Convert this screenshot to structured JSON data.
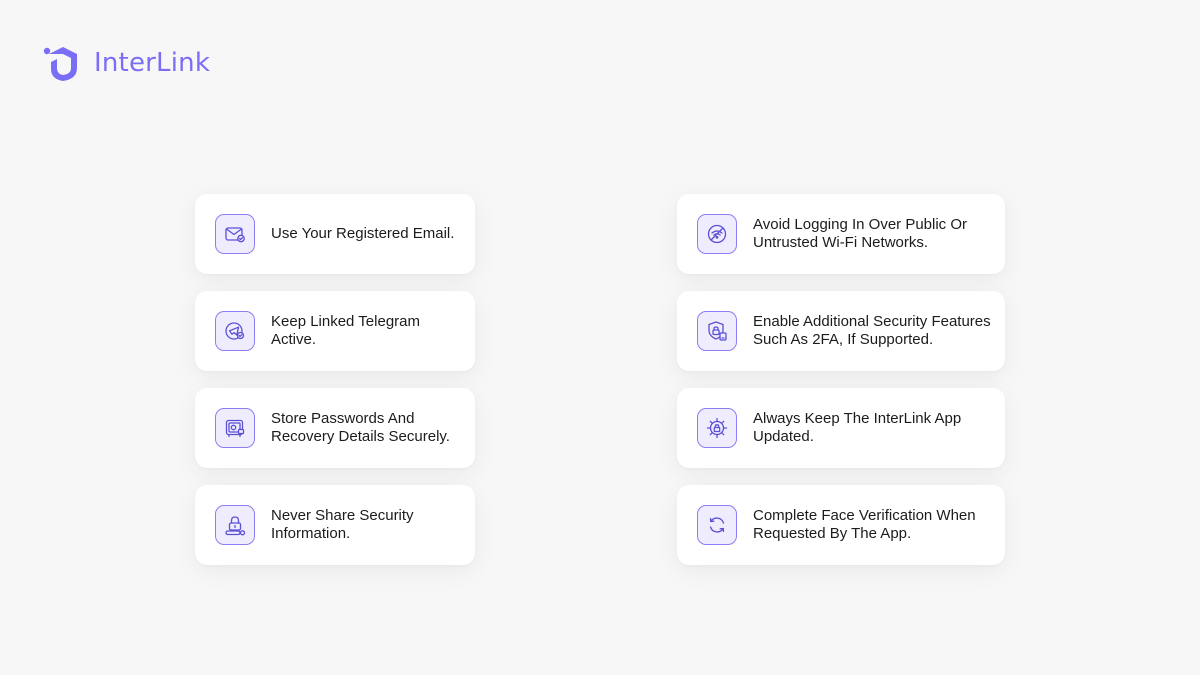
{
  "brand": {
    "name": "InterLink",
    "accent": "#7b6ef6"
  },
  "left_tips": [
    {
      "icon": "email-check-icon",
      "text": "Use Your Registered Email."
    },
    {
      "icon": "telegram-check-icon",
      "text": "Keep Linked Telegram Active."
    },
    {
      "icon": "safe-icon",
      "text": "Store Passwords And Recovery Details Securely."
    },
    {
      "icon": "lock-password-icon",
      "text": "Never Share Security Information."
    }
  ],
  "right_tips": [
    {
      "icon": "wifi-blocked-icon",
      "text": "Avoid Logging In Over Public Or Untrusted Wi-Fi Networks."
    },
    {
      "icon": "shield-lock-icon",
      "text": "Enable Additional Security Features Such As 2FA, If Supported."
    },
    {
      "icon": "gear-lock-icon",
      "text": "Always Keep The InterLink App Updated."
    },
    {
      "icon": "refresh-icon",
      "text": "Complete Face Verification When Requested By The App."
    }
  ]
}
